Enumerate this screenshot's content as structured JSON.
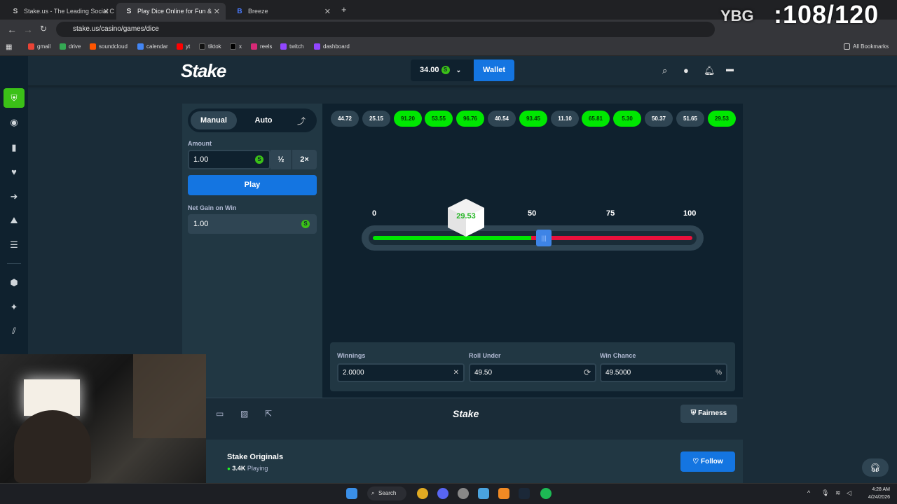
{
  "browser": {
    "tabs": [
      {
        "title": "Stake.us - The Leading Social C"
      },
      {
        "title": "Play Dice Online for Fun &"
      },
      {
        "title": "Breeze"
      }
    ],
    "url": "stake.us/casino/games/dice",
    "bookmarks": [
      "gmail",
      "drive",
      "soundcloud",
      "calendar",
      "yt",
      "tiktok",
      "x",
      "reels",
      "twitch",
      "dashboard"
    ],
    "all_bookmarks": "All Bookmarks"
  },
  "overlay": {
    "counter": ":108/120",
    "badge": "YBG"
  },
  "header": {
    "balance": "34.00",
    "wallet_label": "Wallet"
  },
  "controls": {
    "tab_manual": "Manual",
    "tab_auto": "Auto",
    "amount_label": "Amount",
    "amount_value": "1.00",
    "half": "½",
    "double": "2×",
    "play_label": "Play",
    "net_gain_label": "Net Gain on Win",
    "net_gain_value": "1.00"
  },
  "history": [
    {
      "value": "44.72",
      "win": false
    },
    {
      "value": "25.15",
      "win": false
    },
    {
      "value": "91.20",
      "win": true
    },
    {
      "value": "53.55",
      "win": true
    },
    {
      "value": "96.76",
      "win": true
    },
    {
      "value": "40.54",
      "win": false
    },
    {
      "value": "93.45",
      "win": true
    },
    {
      "value": "11.10",
      "win": false
    },
    {
      "value": "65.81",
      "win": true
    },
    {
      "value": "5.30",
      "win": true
    },
    {
      "value": "50.37",
      "win": false
    },
    {
      "value": "51.65",
      "win": false
    },
    {
      "value": "29.53",
      "win": true
    }
  ],
  "slider": {
    "ticks": [
      "0",
      "50",
      "75",
      "100"
    ],
    "result": "29.53",
    "roll_under_fraction": 0.495
  },
  "stats": {
    "winnings_label": "Winnings",
    "winnings_value": "2.0000",
    "roll_under_label": "Roll Under",
    "roll_under_value": "49.50",
    "win_chance_label": "Win Chance",
    "win_chance_value": "49.5000",
    "percent_symbol": "%"
  },
  "footer": {
    "logo": "Stake",
    "fairness": "Fairness"
  },
  "originals": {
    "title": "Stake Originals",
    "count": "3.4K",
    "playing": "Playing",
    "follow": "Follow"
  },
  "taskbar": {
    "search": "Search",
    "time": "4:28 AM",
    "date": "4/24/2026"
  },
  "colors": {
    "win": "#00e701",
    "lose": "#e9113c",
    "accent": "#1475e1",
    "bg": "#1a2c38"
  }
}
